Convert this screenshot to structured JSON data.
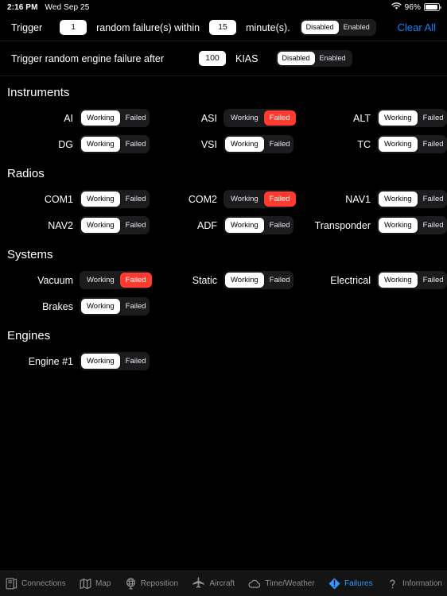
{
  "status_bar": {
    "time": "2:16 PM",
    "date": "Wed Sep 25",
    "battery_percent": "96%",
    "wifi_icon": "wifi-icon",
    "battery_icon": "battery-icon"
  },
  "trigger_random": {
    "prefix_label": "Trigger",
    "count_value": "1",
    "middle_label": "random failure(s) within",
    "minutes_value": "15",
    "suffix_label": "minute(s).",
    "toggle": {
      "options": [
        "Disabled",
        "Enabled"
      ],
      "selected": "Disabled"
    },
    "clear_all_label": "Clear All",
    "clear_all_color": "#0a84ff"
  },
  "trigger_engine": {
    "label": "Trigger random engine failure after",
    "speed_value": "100",
    "unit_label": "KIAS",
    "toggle": {
      "options": [
        "Disabled",
        "Enabled"
      ],
      "selected": "Disabled"
    }
  },
  "segment_options": {
    "working": "Working",
    "failed": "Failed"
  },
  "colors": {
    "failed": "#ff3b30",
    "selected_bg": "#ffffff",
    "track": "#1c1c1e",
    "accent": "#2e9bff"
  },
  "sections": [
    {
      "title": "Instruments",
      "rows": [
        [
          {
            "label": "AI",
            "state": "Working"
          },
          {
            "label": "ASI",
            "state": "Failed"
          },
          {
            "label": "ALT",
            "state": "Working"
          }
        ],
        [
          {
            "label": "DG",
            "state": "Working"
          },
          {
            "label": "VSI",
            "state": "Working"
          },
          {
            "label": "TC",
            "state": "Working"
          }
        ]
      ]
    },
    {
      "title": "Radios",
      "rows": [
        [
          {
            "label": "COM1",
            "state": "Working"
          },
          {
            "label": "COM2",
            "state": "Failed"
          },
          {
            "label": "NAV1",
            "state": "Working"
          }
        ],
        [
          {
            "label": "NAV2",
            "state": "Working"
          },
          {
            "label": "ADF",
            "state": "Working"
          },
          {
            "label": "Transponder",
            "state": "Working"
          }
        ]
      ]
    },
    {
      "title": "Systems",
      "rows": [
        [
          {
            "label": "Vacuum",
            "state": "Failed"
          },
          {
            "label": "Static",
            "state": "Working"
          },
          {
            "label": "Electrical",
            "state": "Working"
          }
        ],
        [
          {
            "label": "Brakes",
            "state": "Working"
          },
          null,
          null
        ]
      ]
    },
    {
      "title": "Engines",
      "rows": [
        [
          {
            "label": "Engine #1",
            "state": "Working"
          },
          null,
          null
        ]
      ]
    }
  ],
  "tabbar": [
    {
      "label": "Connections",
      "icon": "server-icon",
      "active": false
    },
    {
      "label": "Map",
      "icon": "map-icon",
      "active": false
    },
    {
      "label": "Reposition",
      "icon": "globe-icon",
      "active": false
    },
    {
      "label": "Aircraft",
      "icon": "airplane-icon",
      "active": false
    },
    {
      "label": "Time/Weather",
      "icon": "cloud-icon",
      "active": false
    },
    {
      "label": "Failures",
      "icon": "warning-diamond-icon",
      "active": true
    },
    {
      "label": "Information",
      "icon": "question-mark-icon",
      "active": false
    }
  ]
}
